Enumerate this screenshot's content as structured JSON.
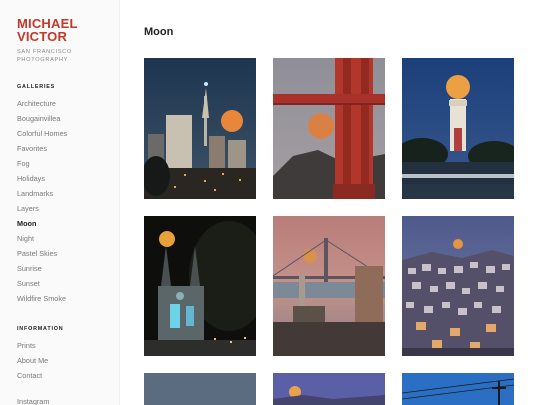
{
  "brand": {
    "line1": "MICHAEL",
    "line2": "VICTOR",
    "tagline1": "SAN FRANCISCO",
    "tagline2": "PHOTOGRAPHY",
    "color": "#c0392b"
  },
  "sidebar": {
    "galleries_heading": "GALLERIES",
    "galleries": [
      "Architecture",
      "Bougainvillea",
      "Colorful Homes",
      "Favorites",
      "Fog",
      "Holidays",
      "Landmarks",
      "Layers",
      "Moon",
      "Night",
      "Pastel Skies",
      "Sunrise",
      "Sunset",
      "Wildfire Smoke"
    ],
    "active_gallery": "Moon",
    "information_heading": "INFORMATION",
    "information": [
      "Prints",
      "About Me",
      "Contact"
    ],
    "social": [
      "Instagram"
    ]
  },
  "main": {
    "title": "Moon",
    "photos": [
      {
        "subject": "Coit-area skyline at dusk with rising moon"
      },
      {
        "subject": "Golden Gate Bridge tower with moon"
      },
      {
        "subject": "Coit Tower with full moon"
      },
      {
        "subject": "Church spires at night with moon"
      },
      {
        "subject": "Bay Bridge and Ferry Building at dusk with moon"
      },
      {
        "subject": "Hillside houses at twilight with moon"
      },
      {
        "subject": "Dusky sky (partially visible)"
      },
      {
        "subject": "Moon over hills at twilight (partially visible)"
      },
      {
        "subject": "Power lines against blue sky (partially visible)"
      }
    ]
  }
}
